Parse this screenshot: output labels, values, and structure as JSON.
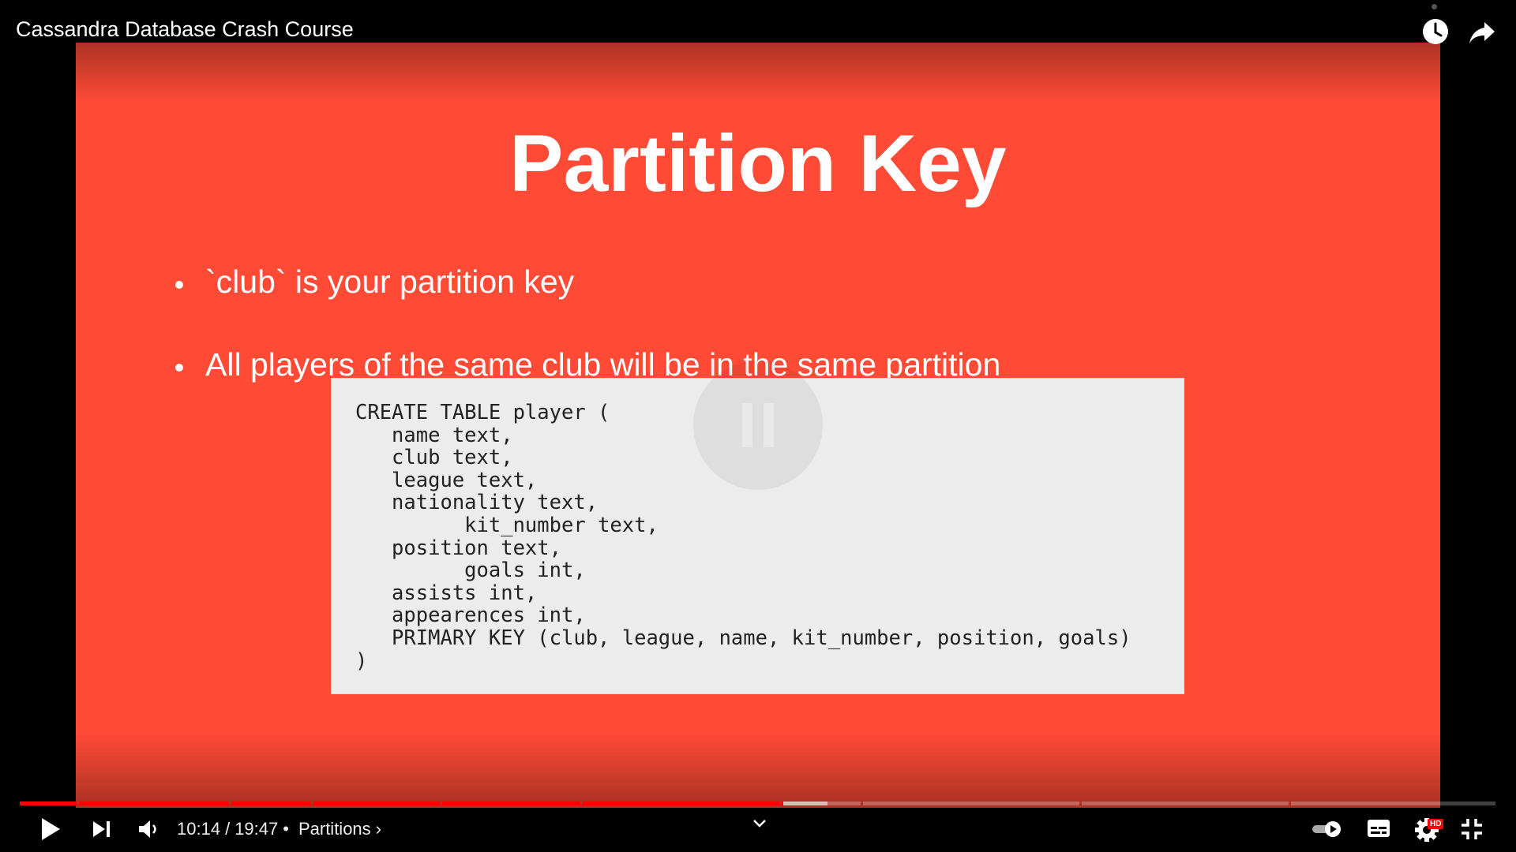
{
  "player": {
    "title": "Cassandra Database Crash Course",
    "current_time": "10:14",
    "duration": "19:47",
    "time_separator": "/",
    "chapter_separator": "•",
    "chapter": "Partitions",
    "chapter_chevron": "›",
    "progress_fraction": 0.517,
    "buffered_fraction": 0.547,
    "hd_badge": "HD"
  },
  "slide": {
    "title": "Partition Key",
    "bullets": [
      "`club` is your partition key",
      "All players of the same club will be in the same partition"
    ],
    "code": "CREATE TABLE player (\n   name text,\n   club text,\n   league text,\n   nationality text,\n         kit_number text,\n   position text,\n         goals int,\n   assists int,\n   appearences int,\n   PRIMARY KEY (club, league, name, kit_number, position, goals)\n)",
    "background_color": "#ff4a36"
  },
  "icons": {
    "watch_later": "clock-icon",
    "share": "share-arrow-icon",
    "play": "play-icon",
    "next": "skip-next-icon",
    "volume": "volume-icon",
    "expand": "chevron-down-icon",
    "autoplay": "autoplay-toggle-icon",
    "subtitles": "subtitles-icon",
    "settings": "gear-icon",
    "exit_fullscreen": "exit-fullscreen-icon"
  }
}
